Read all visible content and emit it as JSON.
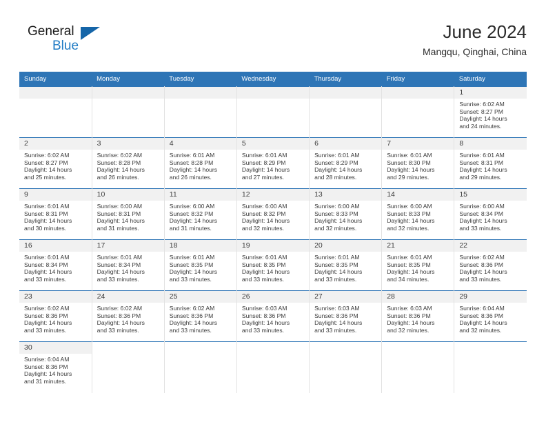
{
  "brand": {
    "name_top": "General",
    "name_bottom": "Blue",
    "triangle_color": "#1565a8",
    "blue_color": "#1f7bc4"
  },
  "header": {
    "title": "June 2024",
    "subtitle": "Mangqu, Qinghai, China"
  },
  "theme": {
    "header_blue": "#2e75b6",
    "daynum_bg": "#f1f1f1",
    "grid_line": "#e2e2e2"
  },
  "weekdays": [
    "Sunday",
    "Monday",
    "Tuesday",
    "Wednesday",
    "Thursday",
    "Friday",
    "Saturday"
  ],
  "weeks": [
    [
      {
        "day": "",
        "sunrise": "",
        "sunset": "",
        "daylight_line1": "",
        "daylight_line2": ""
      },
      {
        "day": "",
        "sunrise": "",
        "sunset": "",
        "daylight_line1": "",
        "daylight_line2": ""
      },
      {
        "day": "",
        "sunrise": "",
        "sunset": "",
        "daylight_line1": "",
        "daylight_line2": ""
      },
      {
        "day": "",
        "sunrise": "",
        "sunset": "",
        "daylight_line1": "",
        "daylight_line2": ""
      },
      {
        "day": "",
        "sunrise": "",
        "sunset": "",
        "daylight_line1": "",
        "daylight_line2": ""
      },
      {
        "day": "",
        "sunrise": "",
        "sunset": "",
        "daylight_line1": "",
        "daylight_line2": ""
      },
      {
        "day": "1",
        "sunrise": "Sunrise: 6:02 AM",
        "sunset": "Sunset: 8:27 PM",
        "daylight_line1": "Daylight: 14 hours",
        "daylight_line2": "and 24 minutes."
      }
    ],
    [
      {
        "day": "2",
        "sunrise": "Sunrise: 6:02 AM",
        "sunset": "Sunset: 8:27 PM",
        "daylight_line1": "Daylight: 14 hours",
        "daylight_line2": "and 25 minutes."
      },
      {
        "day": "3",
        "sunrise": "Sunrise: 6:02 AM",
        "sunset": "Sunset: 8:28 PM",
        "daylight_line1": "Daylight: 14 hours",
        "daylight_line2": "and 26 minutes."
      },
      {
        "day": "4",
        "sunrise": "Sunrise: 6:01 AM",
        "sunset": "Sunset: 8:28 PM",
        "daylight_line1": "Daylight: 14 hours",
        "daylight_line2": "and 26 minutes."
      },
      {
        "day": "5",
        "sunrise": "Sunrise: 6:01 AM",
        "sunset": "Sunset: 8:29 PM",
        "daylight_line1": "Daylight: 14 hours",
        "daylight_line2": "and 27 minutes."
      },
      {
        "day": "6",
        "sunrise": "Sunrise: 6:01 AM",
        "sunset": "Sunset: 8:29 PM",
        "daylight_line1": "Daylight: 14 hours",
        "daylight_line2": "and 28 minutes."
      },
      {
        "day": "7",
        "sunrise": "Sunrise: 6:01 AM",
        "sunset": "Sunset: 8:30 PM",
        "daylight_line1": "Daylight: 14 hours",
        "daylight_line2": "and 29 minutes."
      },
      {
        "day": "8",
        "sunrise": "Sunrise: 6:01 AM",
        "sunset": "Sunset: 8:31 PM",
        "daylight_line1": "Daylight: 14 hours",
        "daylight_line2": "and 29 minutes."
      }
    ],
    [
      {
        "day": "9",
        "sunrise": "Sunrise: 6:01 AM",
        "sunset": "Sunset: 8:31 PM",
        "daylight_line1": "Daylight: 14 hours",
        "daylight_line2": "and 30 minutes."
      },
      {
        "day": "10",
        "sunrise": "Sunrise: 6:00 AM",
        "sunset": "Sunset: 8:31 PM",
        "daylight_line1": "Daylight: 14 hours",
        "daylight_line2": "and 31 minutes."
      },
      {
        "day": "11",
        "sunrise": "Sunrise: 6:00 AM",
        "sunset": "Sunset: 8:32 PM",
        "daylight_line1": "Daylight: 14 hours",
        "daylight_line2": "and 31 minutes."
      },
      {
        "day": "12",
        "sunrise": "Sunrise: 6:00 AM",
        "sunset": "Sunset: 8:32 PM",
        "daylight_line1": "Daylight: 14 hours",
        "daylight_line2": "and 32 minutes."
      },
      {
        "day": "13",
        "sunrise": "Sunrise: 6:00 AM",
        "sunset": "Sunset: 8:33 PM",
        "daylight_line1": "Daylight: 14 hours",
        "daylight_line2": "and 32 minutes."
      },
      {
        "day": "14",
        "sunrise": "Sunrise: 6:00 AM",
        "sunset": "Sunset: 8:33 PM",
        "daylight_line1": "Daylight: 14 hours",
        "daylight_line2": "and 32 minutes."
      },
      {
        "day": "15",
        "sunrise": "Sunrise: 6:00 AM",
        "sunset": "Sunset: 8:34 PM",
        "daylight_line1": "Daylight: 14 hours",
        "daylight_line2": "and 33 minutes."
      }
    ],
    [
      {
        "day": "16",
        "sunrise": "Sunrise: 6:01 AM",
        "sunset": "Sunset: 8:34 PM",
        "daylight_line1": "Daylight: 14 hours",
        "daylight_line2": "and 33 minutes."
      },
      {
        "day": "17",
        "sunrise": "Sunrise: 6:01 AM",
        "sunset": "Sunset: 8:34 PM",
        "daylight_line1": "Daylight: 14 hours",
        "daylight_line2": "and 33 minutes."
      },
      {
        "day": "18",
        "sunrise": "Sunrise: 6:01 AM",
        "sunset": "Sunset: 8:35 PM",
        "daylight_line1": "Daylight: 14 hours",
        "daylight_line2": "and 33 minutes."
      },
      {
        "day": "19",
        "sunrise": "Sunrise: 6:01 AM",
        "sunset": "Sunset: 8:35 PM",
        "daylight_line1": "Daylight: 14 hours",
        "daylight_line2": "and 33 minutes."
      },
      {
        "day": "20",
        "sunrise": "Sunrise: 6:01 AM",
        "sunset": "Sunset: 8:35 PM",
        "daylight_line1": "Daylight: 14 hours",
        "daylight_line2": "and 33 minutes."
      },
      {
        "day": "21",
        "sunrise": "Sunrise: 6:01 AM",
        "sunset": "Sunset: 8:35 PM",
        "daylight_line1": "Daylight: 14 hours",
        "daylight_line2": "and 34 minutes."
      },
      {
        "day": "22",
        "sunrise": "Sunrise: 6:02 AM",
        "sunset": "Sunset: 8:36 PM",
        "daylight_line1": "Daylight: 14 hours",
        "daylight_line2": "and 33 minutes."
      }
    ],
    [
      {
        "day": "23",
        "sunrise": "Sunrise: 6:02 AM",
        "sunset": "Sunset: 8:36 PM",
        "daylight_line1": "Daylight: 14 hours",
        "daylight_line2": "and 33 minutes."
      },
      {
        "day": "24",
        "sunrise": "Sunrise: 6:02 AM",
        "sunset": "Sunset: 8:36 PM",
        "daylight_line1": "Daylight: 14 hours",
        "daylight_line2": "and 33 minutes."
      },
      {
        "day": "25",
        "sunrise": "Sunrise: 6:02 AM",
        "sunset": "Sunset: 8:36 PM",
        "daylight_line1": "Daylight: 14 hours",
        "daylight_line2": "and 33 minutes."
      },
      {
        "day": "26",
        "sunrise": "Sunrise: 6:03 AM",
        "sunset": "Sunset: 8:36 PM",
        "daylight_line1": "Daylight: 14 hours",
        "daylight_line2": "and 33 minutes."
      },
      {
        "day": "27",
        "sunrise": "Sunrise: 6:03 AM",
        "sunset": "Sunset: 8:36 PM",
        "daylight_line1": "Daylight: 14 hours",
        "daylight_line2": "and 33 minutes."
      },
      {
        "day": "28",
        "sunrise": "Sunrise: 6:03 AM",
        "sunset": "Sunset: 8:36 PM",
        "daylight_line1": "Daylight: 14 hours",
        "daylight_line2": "and 32 minutes."
      },
      {
        "day": "29",
        "sunrise": "Sunrise: 6:04 AM",
        "sunset": "Sunset: 8:36 PM",
        "daylight_line1": "Daylight: 14 hours",
        "daylight_line2": "and 32 minutes."
      }
    ],
    [
      {
        "day": "30",
        "sunrise": "Sunrise: 6:04 AM",
        "sunset": "Sunset: 8:36 PM",
        "daylight_line1": "Daylight: 14 hours",
        "daylight_line2": "and 31 minutes."
      },
      {
        "day": "",
        "sunrise": "",
        "sunset": "",
        "daylight_line1": "",
        "daylight_line2": ""
      },
      {
        "day": "",
        "sunrise": "",
        "sunset": "",
        "daylight_line1": "",
        "daylight_line2": ""
      },
      {
        "day": "",
        "sunrise": "",
        "sunset": "",
        "daylight_line1": "",
        "daylight_line2": ""
      },
      {
        "day": "",
        "sunrise": "",
        "sunset": "",
        "daylight_line1": "",
        "daylight_line2": ""
      },
      {
        "day": "",
        "sunrise": "",
        "sunset": "",
        "daylight_line1": "",
        "daylight_line2": ""
      },
      {
        "day": "",
        "sunrise": "",
        "sunset": "",
        "daylight_line1": "",
        "daylight_line2": ""
      }
    ]
  ]
}
